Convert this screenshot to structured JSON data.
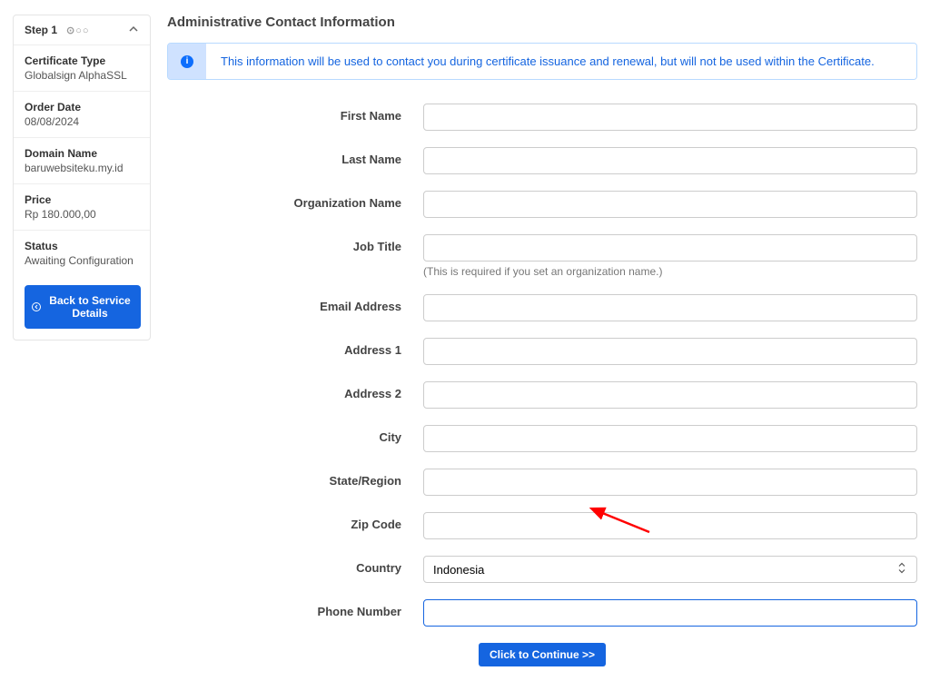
{
  "sidebar": {
    "step_label": "Step 1",
    "step_dots": "⊙○○",
    "summary": [
      {
        "label": "Certificate Type",
        "value": "Globalsign AlphaSSL"
      },
      {
        "label": "Order Date",
        "value": "08/08/2024"
      },
      {
        "label": "Domain Name",
        "value": "baruwebsiteku.my.id"
      },
      {
        "label": "Price",
        "value": "Rp 180.000,00"
      },
      {
        "label": "Status",
        "value": "Awaiting Configuration"
      }
    ],
    "back_button": "Back to Service Details"
  },
  "section_title": "Administrative Contact Information",
  "info_banner": "This information will be used to contact you during certificate issuance and renewal, but will not be used within the Certificate.",
  "form": {
    "first_name": {
      "label": "First Name",
      "value": ""
    },
    "last_name": {
      "label": "Last Name",
      "value": ""
    },
    "org_name": {
      "label": "Organization Name",
      "value": ""
    },
    "job_title": {
      "label": "Job Title",
      "value": "",
      "helper": "(This is required if you set an organization name.)"
    },
    "email": {
      "label": "Email Address",
      "value": ""
    },
    "address1": {
      "label": "Address 1",
      "value": ""
    },
    "address2": {
      "label": "Address 2",
      "value": ""
    },
    "city": {
      "label": "City",
      "value": ""
    },
    "state": {
      "label": "State/Region",
      "value": ""
    },
    "zip": {
      "label": "Zip Code",
      "value": ""
    },
    "country": {
      "label": "Country",
      "selected": "Indonesia"
    },
    "phone": {
      "label": "Phone Number",
      "value": ""
    }
  },
  "continue_button": "Click to Continue >>"
}
